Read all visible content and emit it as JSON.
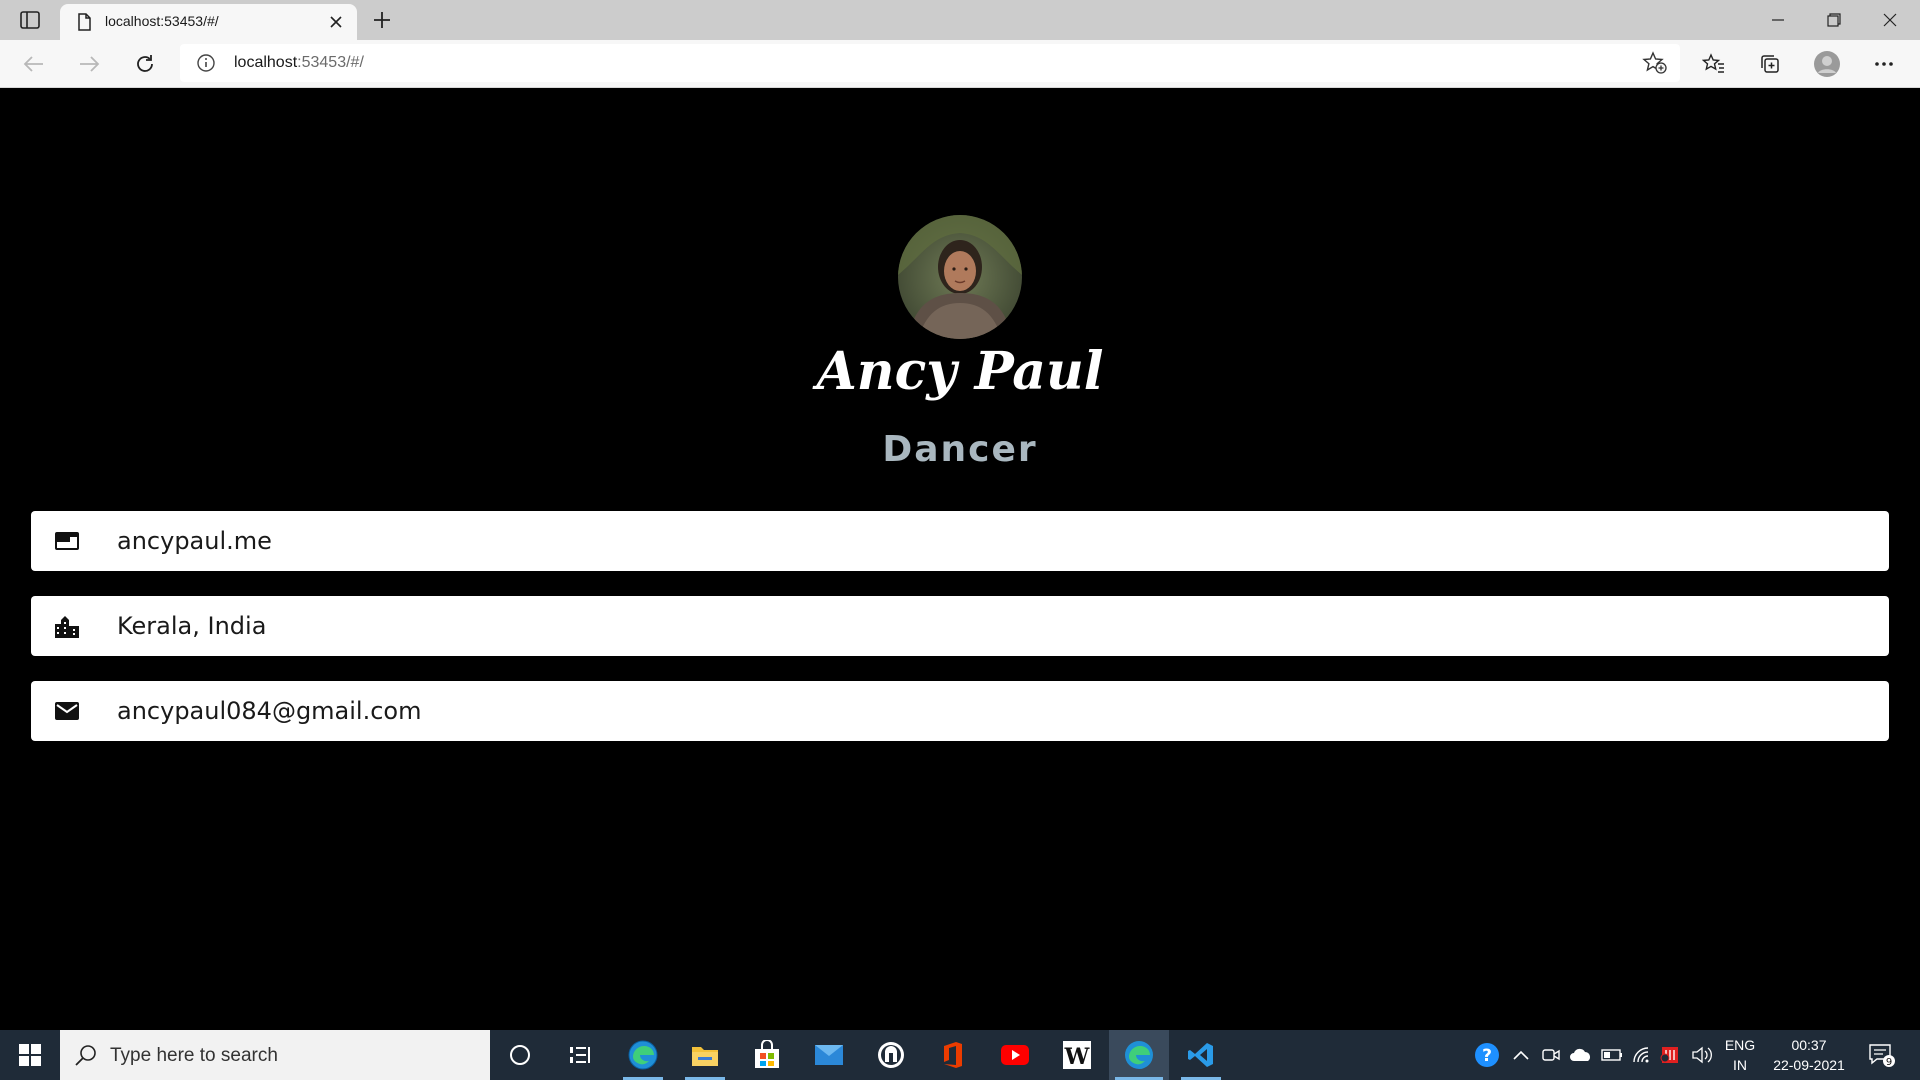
{
  "browser": {
    "tab_title": "localhost:53453/#/",
    "url_host": "localhost",
    "url_rest": ":53453/#/"
  },
  "profile": {
    "name": "Ancy Paul",
    "role": "Dancer",
    "cards": [
      {
        "icon": "web-icon",
        "text": "ancypaul.me"
      },
      {
        "icon": "location-city-icon",
        "text": "Kerala, India"
      },
      {
        "icon": "mail-icon",
        "text": "ancypaul084@gmail.com"
      }
    ]
  },
  "taskbar": {
    "search_placeholder": "Type here to search",
    "lang_top": "ENG",
    "lang_bottom": "IN",
    "time": "00:37",
    "date": "22-09-2021",
    "notification_count": "9"
  }
}
